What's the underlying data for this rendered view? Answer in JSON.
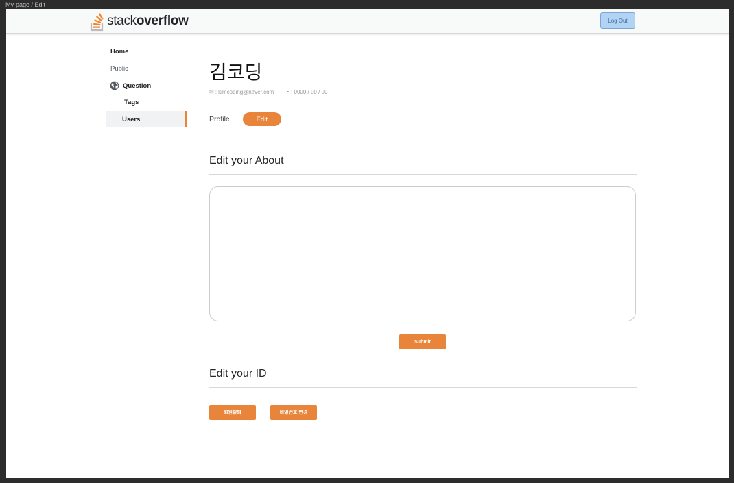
{
  "frame_label": "My-page / Edit",
  "header": {
    "logo_text_light": "stack",
    "logo_text_bold": "overflow",
    "logout_label": "Log Out"
  },
  "sidebar": {
    "items": [
      {
        "label": "Home"
      },
      {
        "label": "Public"
      },
      {
        "label": "Question",
        "icon": "globe-icon"
      },
      {
        "label": "Tags"
      },
      {
        "label": "Users",
        "active": true
      }
    ]
  },
  "profile": {
    "name": "김코딩",
    "email_text": ": kimcoding@naver.com",
    "birthday_text": ": 0000 / 00 / 00",
    "tabs": [
      {
        "label": "Profile",
        "active": false
      },
      {
        "label": "Edit",
        "active": true
      }
    ]
  },
  "about_section": {
    "title": "Edit your About",
    "textarea_value": "",
    "submit_label": "Submit"
  },
  "id_section": {
    "title": "Edit your ID",
    "withdraw_label": "회원탈퇴",
    "change_password_label": "비밀번호 변경"
  },
  "colors": {
    "accent": "#e8853b",
    "logout_bg": "#b3d3f5",
    "logout_text": "#39739d"
  }
}
